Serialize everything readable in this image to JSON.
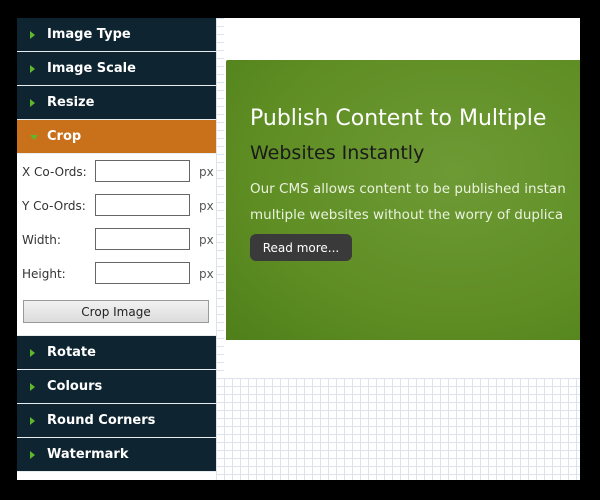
{
  "sidebar": {
    "sections_top": [
      {
        "label": "Image Type"
      },
      {
        "label": "Image Scale"
      },
      {
        "label": "Resize"
      }
    ],
    "active_section": {
      "label": "Crop"
    },
    "sections_bottom": [
      {
        "label": "Rotate"
      },
      {
        "label": "Colours"
      },
      {
        "label": "Round Corners"
      },
      {
        "label": "Watermark"
      }
    ],
    "crop": {
      "fields": [
        {
          "label": "X Co-Ords:",
          "value": "",
          "unit": "px"
        },
        {
          "label": "Y Co-Ords:",
          "value": "",
          "unit": "px"
        },
        {
          "label": "Width:",
          "value": "",
          "unit": "px"
        },
        {
          "label": "Height:",
          "value": "",
          "unit": "px"
        }
      ],
      "button_label": "Crop Image"
    }
  },
  "preview": {
    "title_line1": "Publish Content to Multiple",
    "title_line2": "Websites Instantly",
    "desc_line1": "Our CMS allows content to be published instan",
    "desc_line2": "multiple websites without the worry of duplica",
    "read_more_label": "Read more..."
  },
  "colors": {
    "header_bg": "#0e2430",
    "active_header_bg": "#c8701a",
    "arrow": "#5fb82c",
    "banner_green": "#5f8e24"
  }
}
